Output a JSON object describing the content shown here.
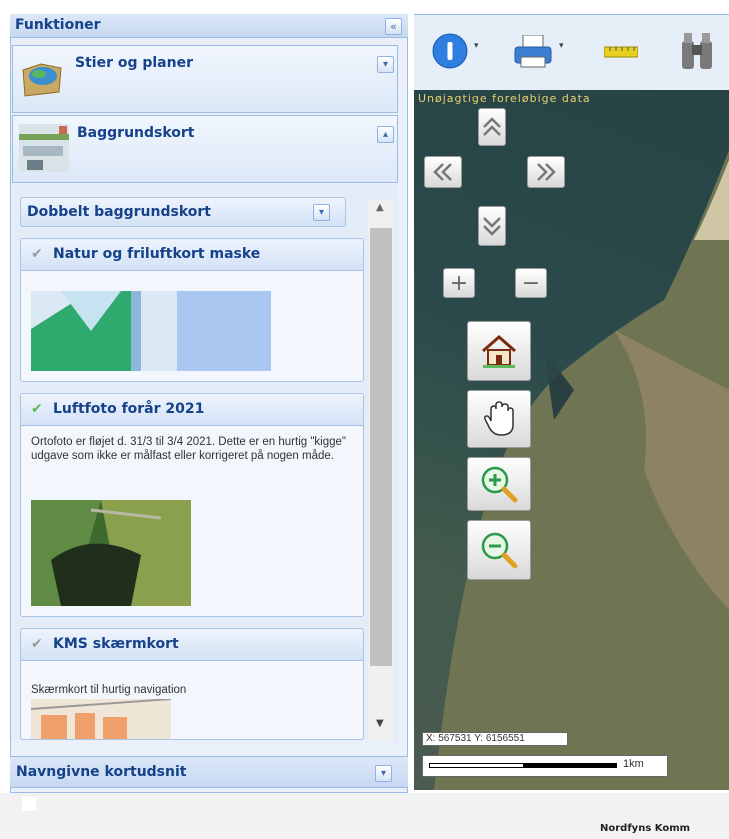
{
  "panel": {
    "title": "Funktioner",
    "stier_label": "Stier og planer",
    "baggrund_label": "Baggrundskort",
    "dropdown_label": "Dobbelt baggrundskort",
    "layers": [
      {
        "title": "Natur og friluftkort maske",
        "checked": false
      },
      {
        "title": "Luftfoto forår 2021",
        "checked": true,
        "desc": "Ortofoto er fløjet d. 31/3 til 3/4 2021. Dette er en hurtig \"kigge\" udgave som ikke er målfast eller korrigeret på nogen måde."
      },
      {
        "title": "KMS skærmkort",
        "checked": false,
        "desc": "Skærmkort til hurtig navigation"
      }
    ],
    "bottom_label": "Navngivne kortudsnit"
  },
  "map": {
    "watermark": "Unøjagtige foreløbige data",
    "coords": "X: 567531 Y: 6156551",
    "scale": "1km"
  },
  "footer": {
    "text": "Nordfyns Komm"
  },
  "colors": {
    "header_text": "#15428b",
    "border": "#99bbe8",
    "check_on": "#5cb85c",
    "check_off": "#9a9a9a"
  }
}
